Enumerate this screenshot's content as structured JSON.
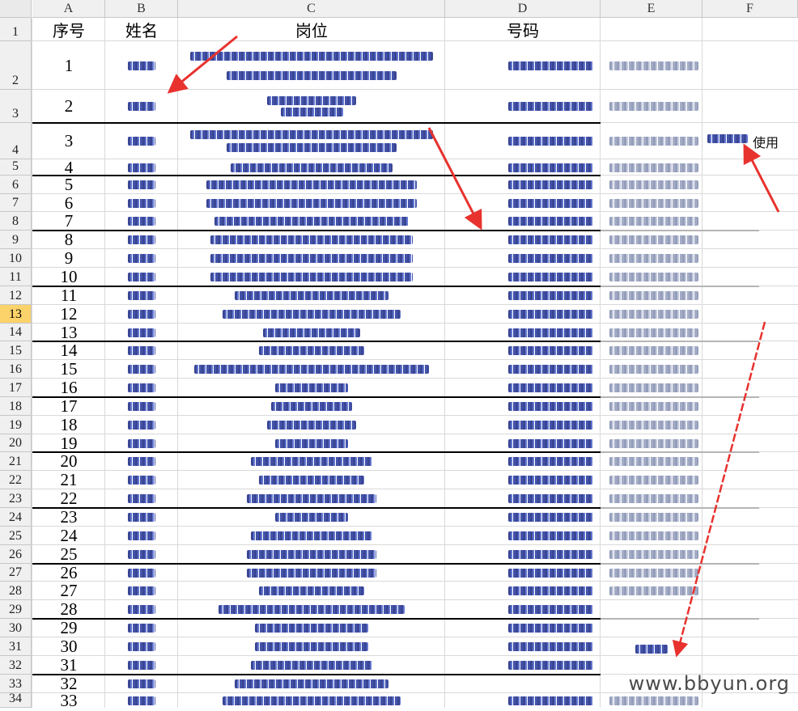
{
  "sheet": {
    "columns": [
      "A",
      "B",
      "C",
      "D",
      "E",
      "F"
    ],
    "rows": [
      "1",
      "2",
      "3",
      "4",
      "5",
      "6",
      "7",
      "8",
      "9",
      "10",
      "11",
      "12",
      "13",
      "14",
      "15",
      "16",
      "17",
      "18",
      "19",
      "20",
      "21",
      "22",
      "23",
      "24",
      "25",
      "26",
      "27",
      "28",
      "29",
      "30",
      "31",
      "32",
      "33",
      "34"
    ],
    "selected_row": "13",
    "headers": {
      "seq": "序号",
      "name": "姓名",
      "position": "岗位",
      "number": "号码"
    },
    "seq_numbers": [
      "1",
      "2",
      "3",
      "4",
      "5",
      "6",
      "7",
      "8",
      "9",
      "10",
      "11",
      "12",
      "13",
      "14",
      "15",
      "16",
      "17",
      "18",
      "19",
      "20",
      "21",
      "22",
      "23",
      "24",
      "25",
      "26",
      "27",
      "28",
      "29",
      "30",
      "31",
      "32",
      "33"
    ],
    "side_note": "使用",
    "watermark": "www.bbyun.org"
  },
  "colors": {
    "arrow": "#e8322e",
    "selected_row": "#fbd36a",
    "blur": "#2a3d9e"
  }
}
